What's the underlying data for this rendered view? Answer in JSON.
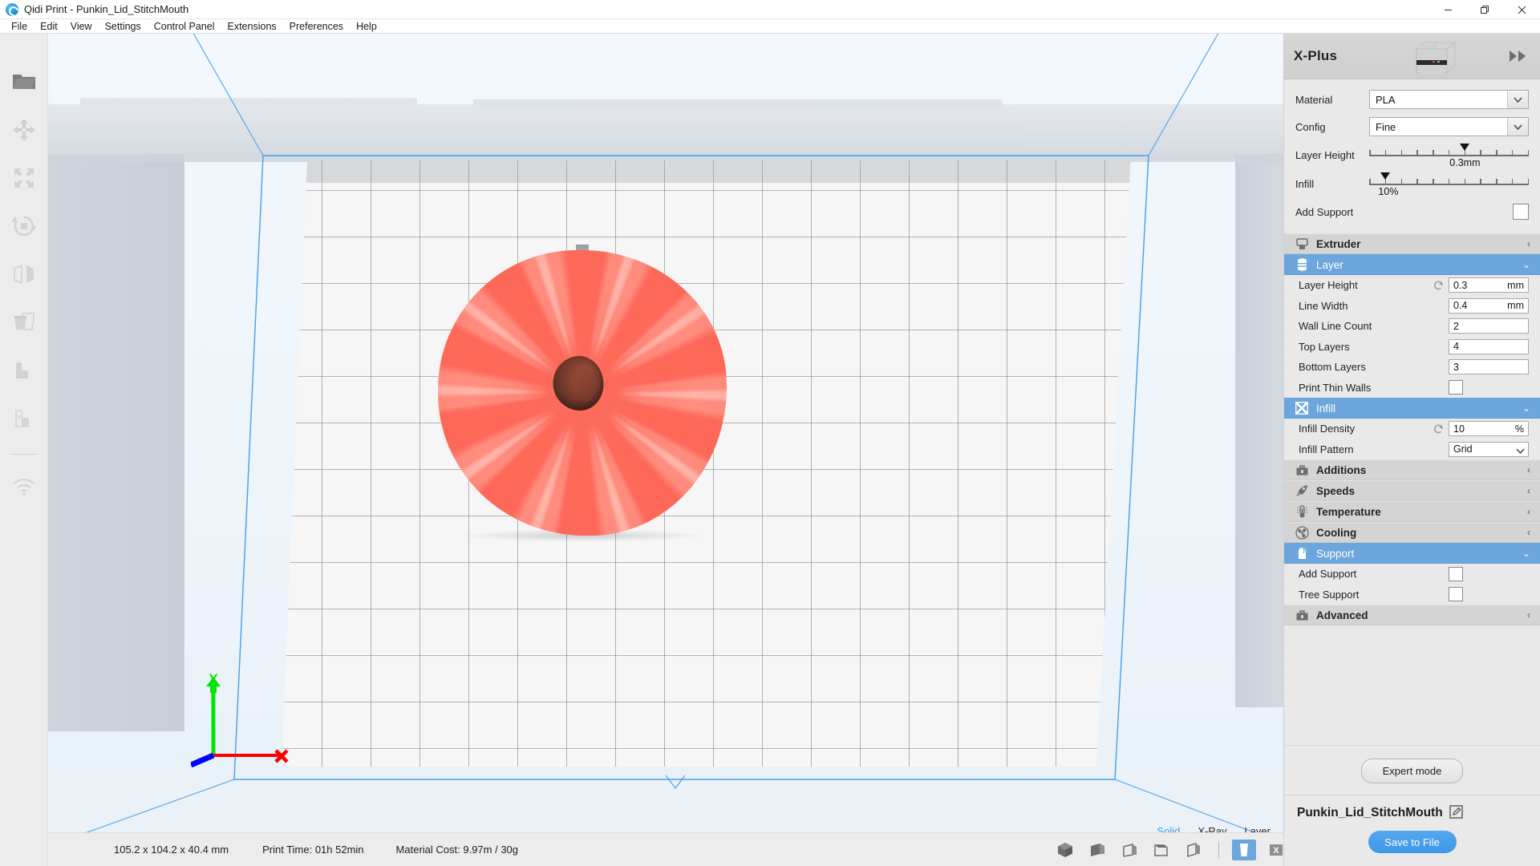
{
  "window": {
    "title": "Qidi Print - Punkin_Lid_StitchMouth",
    "app_icon": "qidi-logo-icon",
    "minimize": "—",
    "maximize": "❐",
    "close": "✕"
  },
  "menubar": {
    "items": [
      {
        "label": "File"
      },
      {
        "label": "Edit"
      },
      {
        "label": "View"
      },
      {
        "label": "Settings"
      },
      {
        "label": "Control Panel"
      },
      {
        "label": "Extensions"
      },
      {
        "label": "Preferences"
      },
      {
        "label": "Help"
      }
    ]
  },
  "left_toolbar": {
    "items": [
      {
        "icon": "open-file-icon",
        "name": "open-file"
      },
      {
        "icon": "move-icon",
        "name": "move-tool"
      },
      {
        "icon": "scale-icon",
        "name": "scale-tool"
      },
      {
        "icon": "rotate-icon",
        "name": "rotate-tool"
      },
      {
        "icon": "mirror-icon",
        "name": "mirror-tool"
      },
      {
        "icon": "duplicate-icon",
        "name": "duplicate-tool"
      },
      {
        "icon": "support-blocker-icon",
        "name": "support-blocker-tool"
      },
      {
        "icon": "per-model-settings-icon",
        "name": "per-model-settings-tool"
      },
      {
        "icon": "wifi-icon",
        "name": "wifi-connect"
      }
    ]
  },
  "viewport": {
    "axis": {
      "x_label": "X",
      "y_label": "Y",
      "x_color": "#ff0000",
      "y_color": "#00e600",
      "z_color": "#0000ff"
    },
    "plate_border_color": "#3d9ae8",
    "model_color": "#fc6a5b",
    "stem_color": "#5b3226",
    "view_modes": [
      {
        "label": "Solid",
        "active": true
      },
      {
        "label": "X-Ray",
        "active": false
      },
      {
        "label": "Layer",
        "active": false
      }
    ]
  },
  "right_panel": {
    "printer_name": "X-Plus",
    "printer_thumbnail_icon": "3d-printer-icon",
    "collapse_icon": "double-chevron-right-icon",
    "quick": {
      "material": {
        "label": "Material",
        "value": "PLA"
      },
      "config": {
        "label": "Config",
        "value": "Fine"
      },
      "layer_height": {
        "label": "Layer Height",
        "value": "0.3mm",
        "position_pct": 60,
        "ticks": 11
      },
      "infill": {
        "label": "Infill",
        "value": "10%",
        "position_pct": 10,
        "ticks": 11
      },
      "add_support": {
        "label": "Add Support",
        "checked": false
      }
    },
    "categories": [
      {
        "label": "Extruder",
        "icon": "extruder-icon",
        "open": false,
        "chevron": "‹",
        "settings": []
      },
      {
        "label": "Layer",
        "icon": "layer-stack-icon",
        "open": true,
        "chevron": "⌄",
        "settings": [
          {
            "label": "Layer Height",
            "type": "text",
            "value": "0.3",
            "unit": "mm",
            "reset": true
          },
          {
            "label": "Line Width",
            "type": "text",
            "value": "0.4",
            "unit": "mm",
            "reset": false
          },
          {
            "label": "Wall Line Count",
            "type": "text",
            "value": "2",
            "unit": "",
            "reset": false
          },
          {
            "label": "Top Layers",
            "type": "text",
            "value": "4",
            "unit": "",
            "reset": false
          },
          {
            "label": "Bottom Layers",
            "type": "text",
            "value": "3",
            "unit": "",
            "reset": false
          },
          {
            "label": "Print Thin Walls",
            "type": "checkbox",
            "checked": false
          }
        ]
      },
      {
        "label": "Infill",
        "icon": "infill-grid-icon",
        "open": true,
        "chevron": "⌄",
        "settings": [
          {
            "label": "Infill Density",
            "type": "text",
            "value": "10",
            "unit": "%",
            "reset": true
          },
          {
            "label": "Infill Pattern",
            "type": "select",
            "value": "Grid",
            "unit": "",
            "reset": false
          }
        ]
      },
      {
        "label": "Additions",
        "icon": "toolbox-icon",
        "open": false,
        "chevron": "‹",
        "settings": []
      },
      {
        "label": "Speeds",
        "icon": "rocket-icon",
        "open": false,
        "chevron": "‹",
        "settings": []
      },
      {
        "label": "Temperature",
        "icon": "thermometer-icon",
        "open": false,
        "chevron": "‹",
        "settings": []
      },
      {
        "label": "Cooling",
        "icon": "fan-icon",
        "open": false,
        "chevron": "‹",
        "settings": []
      },
      {
        "label": "Support",
        "icon": "support-icon",
        "open": true,
        "chevron": "⌄",
        "settings": [
          {
            "label": "Add Support",
            "type": "checkbox",
            "checked": false
          },
          {
            "label": "Tree Support",
            "type": "checkbox",
            "checked": false
          }
        ]
      },
      {
        "label": "Advanced",
        "icon": "toolbox-icon",
        "open": false,
        "chevron": "‹",
        "settings": []
      }
    ],
    "expert_button": "Expert mode",
    "model_name": "Punkin_Lid_StitchMouth",
    "edit_icon": "pencil-edit-icon",
    "save_button": "Save to File",
    "accent_color": "#6ca6dc",
    "save_button_color": "#3d97e8"
  },
  "statusbar": {
    "dimensions": "105.2 x 104.2 x 40.4 mm",
    "print_time": "Print Time: 01h 52min",
    "material_cost": "Material Cost: 9.97m / 30g",
    "view_buttons": [
      {
        "icon": "cube-iso-icon",
        "name": "view-3d",
        "active": false
      },
      {
        "icon": "cube-front-icon",
        "name": "view-front",
        "active": false
      },
      {
        "icon": "cube-top-icon",
        "name": "view-top",
        "active": false
      },
      {
        "icon": "cube-left-icon",
        "name": "view-left",
        "active": false
      },
      {
        "icon": "cube-right-icon",
        "name": "view-right",
        "active": false
      }
    ],
    "mode_buttons": [
      {
        "icon": "solid-view-icon",
        "name": "solid-view",
        "active": true
      },
      {
        "icon": "xray-view-icon",
        "name": "xray-view",
        "active": false
      },
      {
        "icon": "layer-view-icon",
        "name": "layer-view",
        "active": false
      }
    ]
  }
}
